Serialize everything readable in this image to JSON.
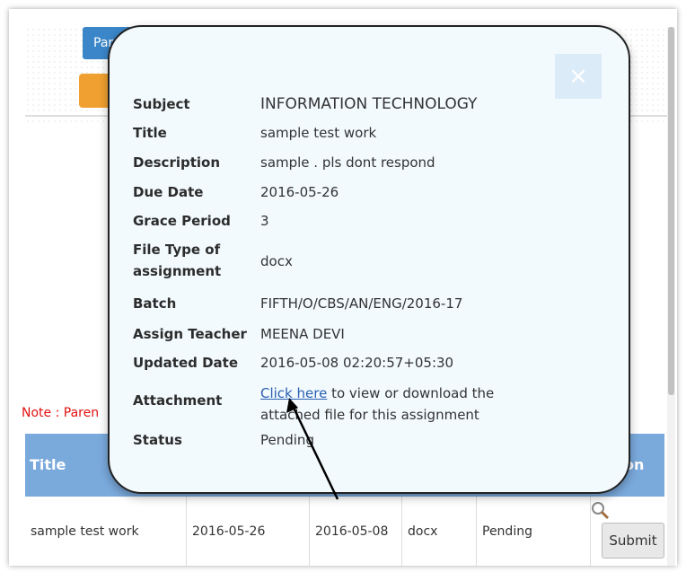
{
  "background": {
    "top_button_text": "Par",
    "note_text": "Note : Paren"
  },
  "table": {
    "headers": {
      "title": "Title",
      "action": "on"
    },
    "row": {
      "title": "sample test work",
      "due_date": "2016-05-26",
      "updated_date": "2016-05-08",
      "file_type": "docx",
      "status": "Pending",
      "submit": "Submit"
    }
  },
  "modal": {
    "close_symbol": "×",
    "fields": {
      "subject": {
        "label": "Subject",
        "value": "INFORMATION TECHNOLOGY"
      },
      "title": {
        "label": "Title",
        "value": "sample test work"
      },
      "description": {
        "label": "Description",
        "value": "sample . pls dont respond"
      },
      "due_date": {
        "label": "Due Date",
        "value": "2016-05-26"
      },
      "grace_period": {
        "label": "Grace Period",
        "value": "3"
      },
      "file_type": {
        "label": "File Type of assignment",
        "value": "docx"
      },
      "batch": {
        "label": "Batch",
        "value": "FIFTH/O/CBS/AN/ENG/2016-17"
      },
      "teacher": {
        "label": "Assign Teacher",
        "value": "MEENA DEVI"
      },
      "updated_date": {
        "label": "Updated Date",
        "value": "2016-05-08 02:20:57+05:30"
      },
      "attachment": {
        "label": "Attachment",
        "link_text": "Click here",
        "rest_text": " to view or download the attached file for this assignment"
      },
      "status": {
        "label": "Status",
        "value": "Pending"
      }
    }
  },
  "icons": {
    "search": "search-icon",
    "close": "close-icon",
    "arrow": "arrow-icon"
  }
}
